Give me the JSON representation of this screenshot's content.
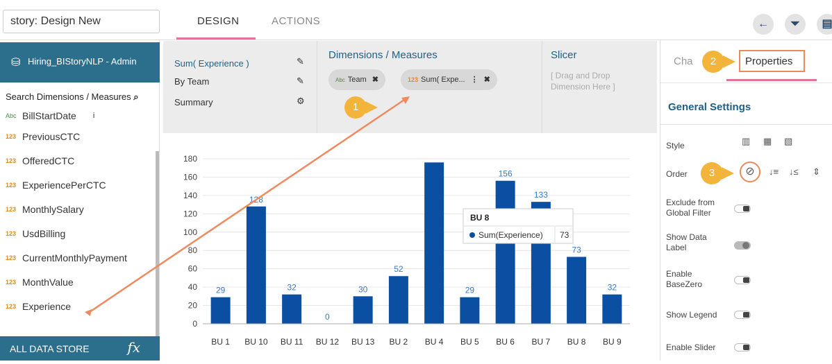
{
  "header": {
    "story_title": "story: Design New",
    "tabs": [
      {
        "label": "DESIGN"
      },
      {
        "label": "ACTIONS"
      }
    ],
    "buttons": [
      {
        "icon": "arrow-left-icon",
        "glyph": "←"
      },
      {
        "icon": "filter-icon",
        "glyph": "⏷"
      },
      {
        "icon": "save-icon",
        "glyph": "▤"
      }
    ]
  },
  "sidebar": {
    "datastore": "Hiring_BIStoryNLP - Admin",
    "search_label": "Search Dimensions / Measures",
    "fields": [
      {
        "type": "Abc",
        "name": "BillStartDate",
        "info": "i"
      },
      {
        "type": "123",
        "name": "PreviousCTC"
      },
      {
        "type": "123",
        "name": "OfferedCTC"
      },
      {
        "type": "123",
        "name": "ExperiencePerCTC"
      },
      {
        "type": "123",
        "name": "MonthlySalary"
      },
      {
        "type": "123",
        "name": "UsdBilling"
      },
      {
        "type": "123",
        "name": "CurrentMonthlyPayment"
      },
      {
        "type": "123",
        "name": "MonthValue"
      },
      {
        "type": "123",
        "name": "Experience"
      }
    ],
    "footer": "ALL DATA STORE",
    "fx": "fx"
  },
  "config": {
    "lines": [
      "Sum( Experience )",
      "By Team",
      "Summary"
    ],
    "dims_title": "Dimensions / Measures",
    "chips": [
      {
        "type": "Abc",
        "label": "Team",
        "close": "✖"
      },
      {
        "type": "123",
        "label": "Sum( Expe...",
        "menu": "⋮",
        "close": "✖"
      }
    ],
    "slicer_title": "Slicer",
    "slicer_hint_1": "[ Drag and Drop",
    "slicer_hint_2": "Dimension Here ]"
  },
  "chart_data": {
    "type": "bar",
    "categories": [
      "BU 1",
      "BU 10",
      "BU 11",
      "BU 12",
      "BU 13",
      "BU 2",
      "BU 4",
      "BU 5",
      "BU 6",
      "BU 7",
      "BU 8",
      "BU 9"
    ],
    "values": [
      29,
      128,
      32,
      0,
      30,
      52,
      176,
      29,
      156,
      133,
      73,
      32
    ],
    "labels": [
      "29",
      "128",
      "32",
      "0",
      "30",
      "52",
      "",
      "29",
      "156",
      "133",
      "73",
      "32"
    ],
    "yticks": [
      0,
      20,
      40,
      60,
      80,
      100,
      120,
      140,
      160,
      180
    ],
    "ylim": [
      0,
      180
    ],
    "color": "#0b4fa3",
    "tooltip": {
      "title": "BU 8",
      "series": "Sum(Experience)",
      "value": "73"
    }
  },
  "right_panel": {
    "tab1": "Cha",
    "tab2": "Properties",
    "section": "General Settings",
    "options": [
      {
        "label": "Style"
      },
      {
        "label": "Order"
      },
      {
        "label": "Exclude from Global Filter",
        "state": "off"
      },
      {
        "label": "Show Data Label",
        "state": "on"
      },
      {
        "label": "Enable BaseZero",
        "state": "off"
      },
      {
        "label": "Show Legend",
        "state": "off"
      },
      {
        "label": "Enable Slider",
        "state": "off"
      }
    ]
  },
  "callouts": [
    "1",
    "2",
    "3"
  ],
  "colors": {
    "accent": "#2b6f8d",
    "tab_underline": "#e07597",
    "callout": "#f3b43b",
    "highlight": "#ea8a5d"
  }
}
